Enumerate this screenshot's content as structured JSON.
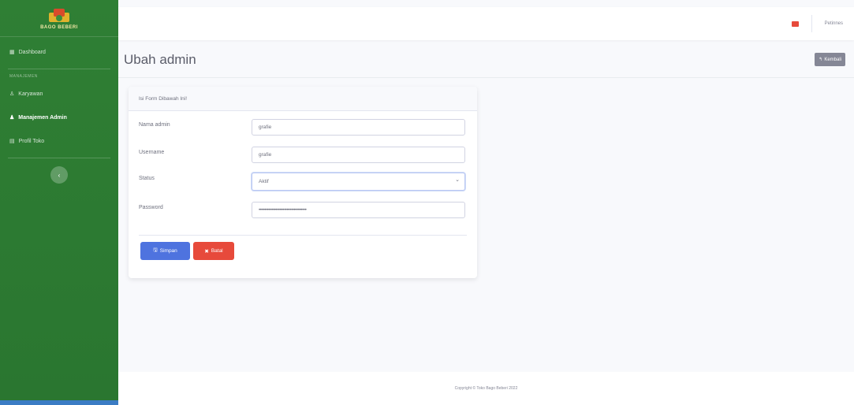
{
  "sidebar": {
    "brand_text": "BAGO BEBERI",
    "items": [
      {
        "label": "Dashboard",
        "icon": "dashboard-icon"
      },
      {
        "label": "Karyawan",
        "icon": "user-icon"
      },
      {
        "label": "Manajemen Admin",
        "icon": "users-cog-icon"
      },
      {
        "label": "Profil Toko",
        "icon": "store-icon"
      }
    ],
    "heading": "MANAJEMEN",
    "toggle_glyph": "‹"
  },
  "topbar": {
    "user_label": "Petinnes"
  },
  "page": {
    "title": "Ubah admin",
    "back_label": "Kembali"
  },
  "form": {
    "header": "Isi Form Dibawah Ini!",
    "fields": [
      {
        "label": "Nama admin",
        "value": "grafie"
      },
      {
        "label": "Username",
        "value": "grafie"
      },
      {
        "label": "Status",
        "value": "Aktif"
      },
      {
        "label": "Password",
        "value": "••••••••••••••••••••••••••••••••••"
      }
    ],
    "save_label": "Simpan",
    "cancel_label": "Batal"
  },
  "footer": {
    "copyright": "Copyright © Toko Bago Beberi 2022"
  },
  "colors": {
    "sidebar": "#2e7d32",
    "primary": "#4e73df",
    "danger": "#e74a3b",
    "secondary": "#858796"
  }
}
